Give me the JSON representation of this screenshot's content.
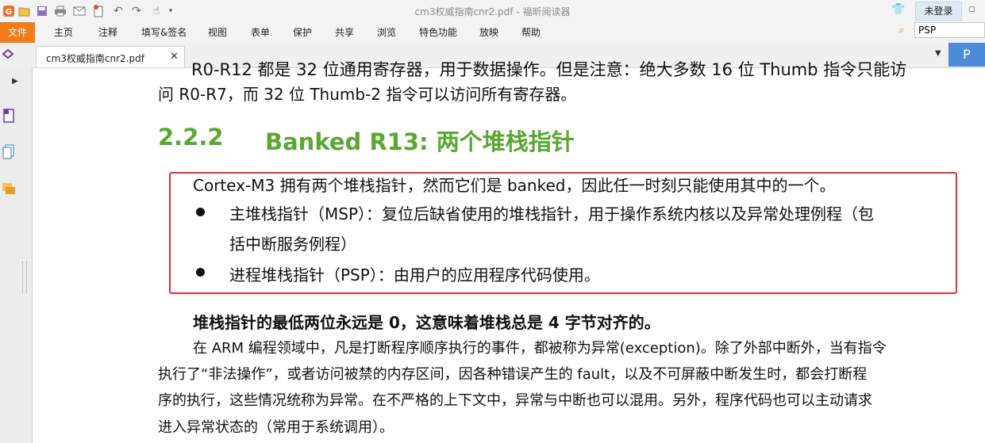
{
  "window": {
    "title": "cm3权威指南cnr2.pdf - 福昕阅读器",
    "login": "未登录"
  },
  "menu": {
    "file": "文件",
    "items": [
      "主页",
      "注释",
      "填写&签名",
      "视图",
      "表单",
      "保护",
      "共享",
      "浏览",
      "特色功能",
      "放映",
      "帮助"
    ]
  },
  "search": {
    "value": "PSP"
  },
  "tab": {
    "label": "cm3权威指南cnr2.pdf",
    "close": "✕"
  },
  "right_panel": {
    "label": "P"
  },
  "icons": [
    "app-logo-icon",
    "open-icon",
    "save-icon",
    "print-icon",
    "email-icon",
    "new-icon",
    "undo-icon",
    "redo-icon",
    "hand-tool-icon",
    "dropdown-icon",
    "skin-icon",
    "window-controls-icon",
    "search-icon",
    "layers-icon",
    "pages-icon",
    "comments-icon"
  ],
  "document": {
    "line_partial": "R0-R12 都是 32 位通用寄存器，用于数据操作。但是注意：绝大多数 16 位 Thumb 指令只能访",
    "line_2": "问 R0-R7，而 32 位 Thumb-2 指令可以访问所有寄存器。",
    "heading_number": "2.2.2",
    "heading_text": "Banked R13: 两个堆栈指针",
    "intro": "Cortex-M3 拥有两个堆栈指针，然而它们是 banked，因此任一时刻只能使用其中的一个。",
    "bullet1_line1": "主堆栈指针（MSP）：复位后缺省使用的堆栈指针，用于操作系统内核以及异常处理例程（包",
    "bullet1_line2": "括中断服务例程）",
    "bullet2": "进程堆栈指针（PSP）：由用户的应用程序代码使用。",
    "bold_note": "堆栈指针的最低两位永远是 0，这意味着堆栈总是 4 字节对齐的。",
    "para_line1": "在 ARM 编程领域中，凡是打断程序顺序执行的事件，都被称为异常(exception)。除了外部中断外，当有指令",
    "para_line2": "执行了“非法操作”，或者访问被禁的内存区间，因各种错误产生的 fault，以及不可屏蔽中断发生时，都会打断程",
    "para_line3": "序的执行，这些情况统称为异常。在不严格的上下文中，异常与中断也可以混用。另外，程序代码也可以主动请求",
    "para_line4": "进入异常状态的（常用于系统调用）。"
  },
  "colors": {
    "heading": "#5aa832",
    "highlight_border": "#e53030",
    "file_menu": "#f07d1a",
    "accent": "#4d8bd9"
  }
}
